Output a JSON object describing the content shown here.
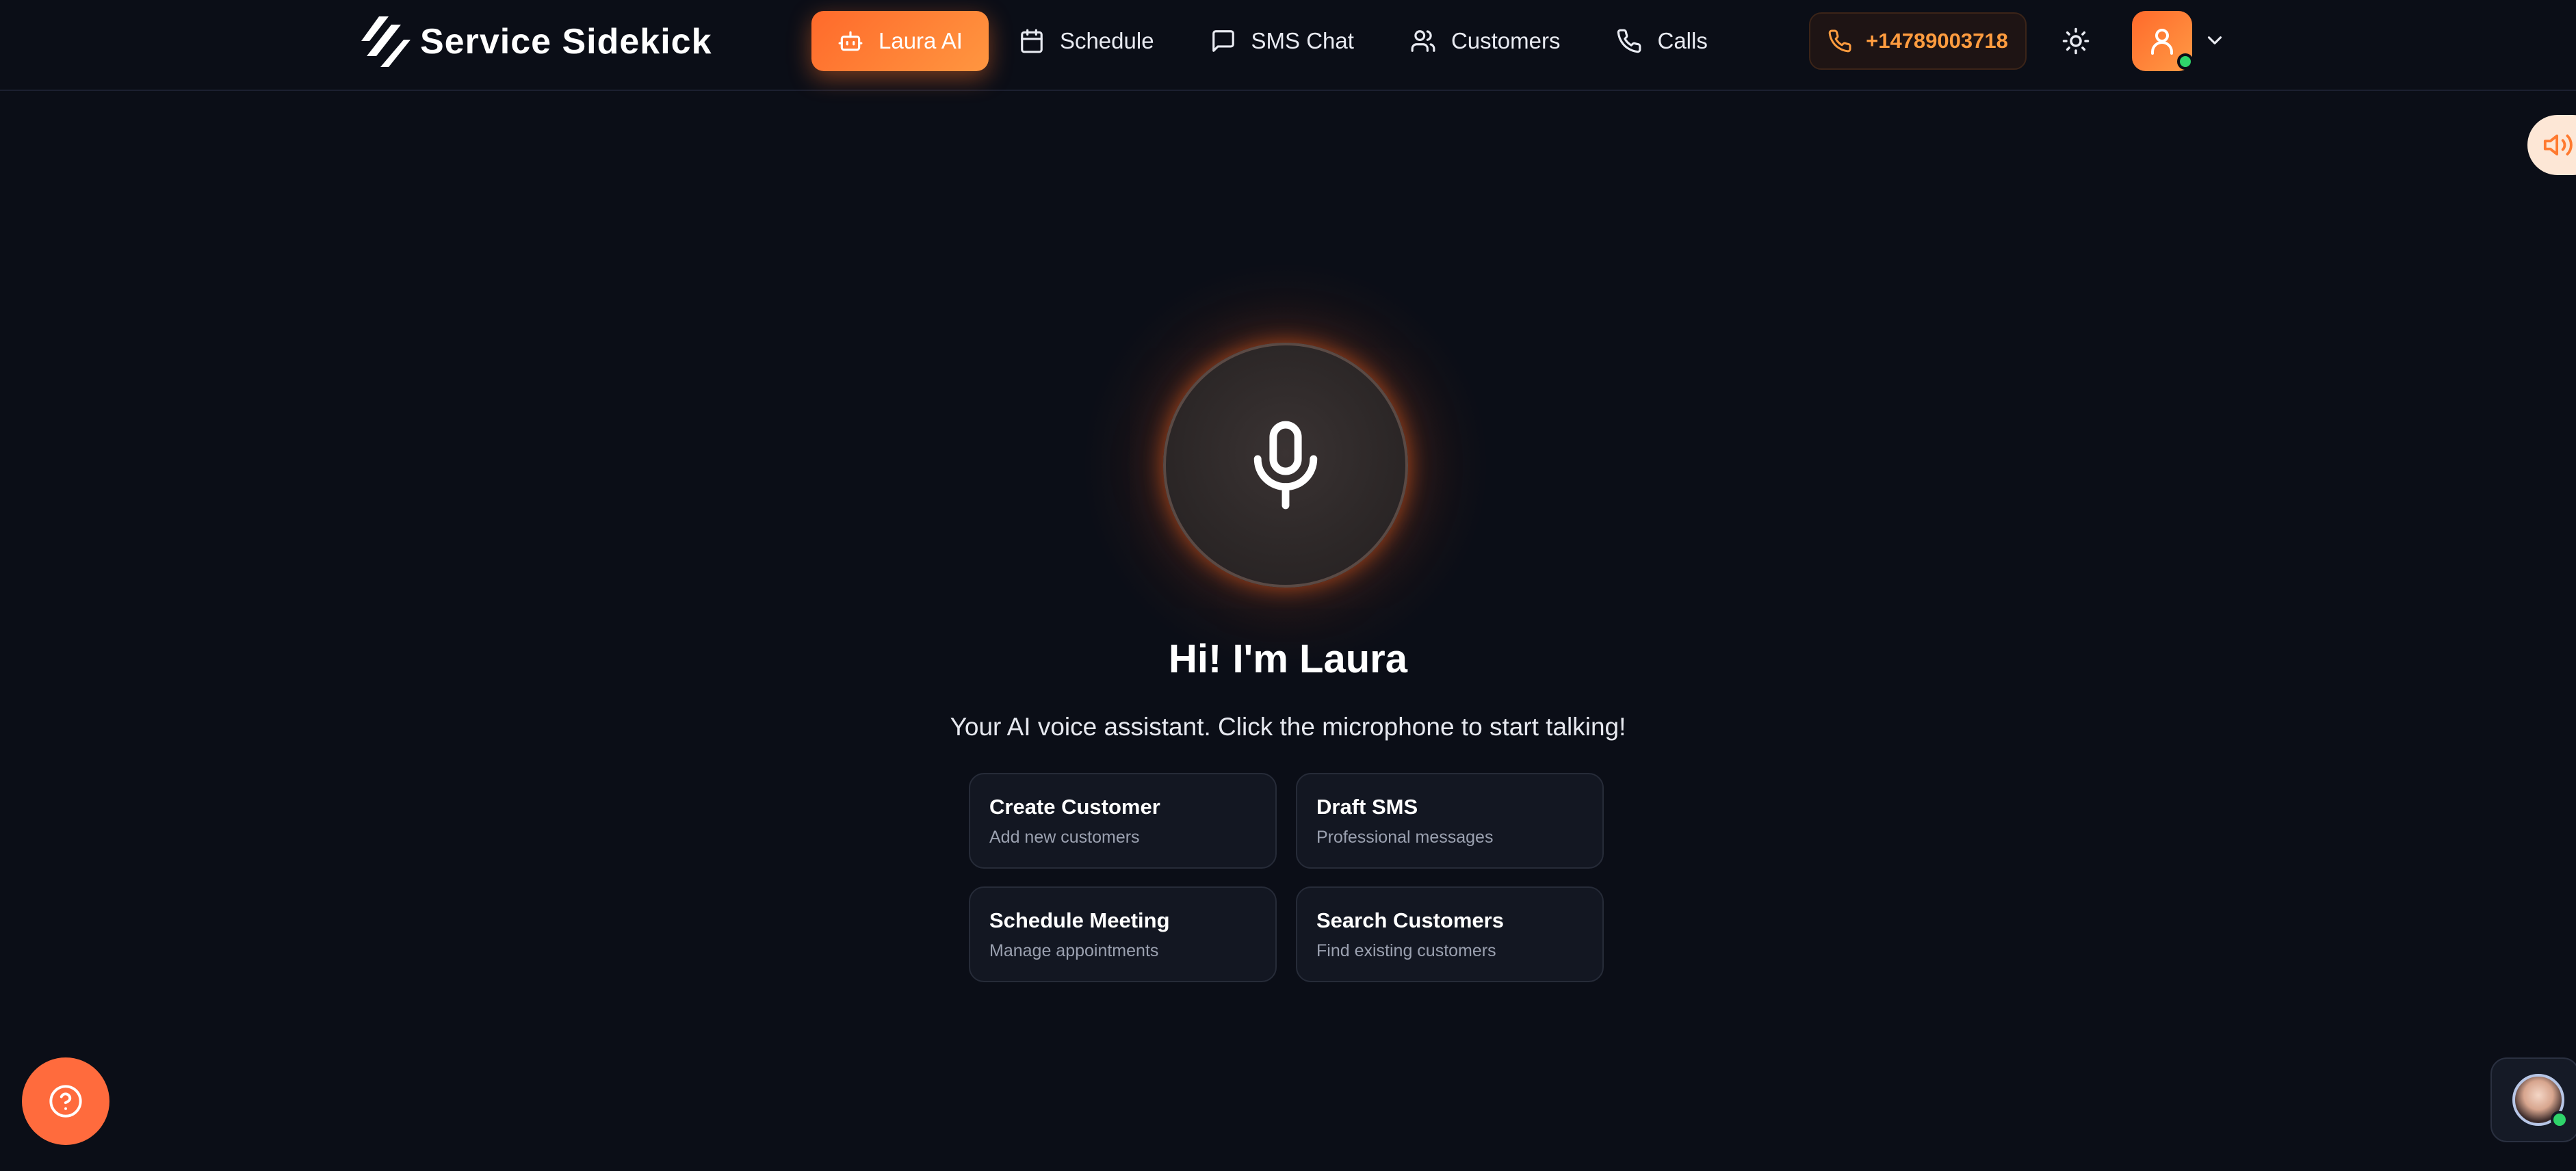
{
  "brand": {
    "name": "Service Sidekick"
  },
  "nav": {
    "items": [
      {
        "label": "Laura AI",
        "icon": "bot-icon",
        "active": true
      },
      {
        "label": "Schedule",
        "icon": "calendar-icon",
        "active": false
      },
      {
        "label": "SMS Chat",
        "icon": "message-icon",
        "active": false
      },
      {
        "label": "Customers",
        "icon": "users-icon",
        "active": false
      },
      {
        "label": "Calls",
        "icon": "phone-icon",
        "active": false
      }
    ]
  },
  "header": {
    "phone_number": "+14789003718",
    "theme_icon": "sun-icon",
    "user_icon": "user-icon",
    "user_status": "online"
  },
  "assistant": {
    "greeting": "Hi! I'm Laura",
    "subtitle": "Your AI voice assistant. Click the microphone to start talking!",
    "mic_icon": "microphone-icon"
  },
  "actions": [
    {
      "title": "Create Customer",
      "subtitle": "Add new customers"
    },
    {
      "title": "Draft SMS",
      "subtitle": "Professional messages"
    },
    {
      "title": "Schedule Meeting",
      "subtitle": "Manage appointments"
    },
    {
      "title": "Search Customers",
      "subtitle": "Find existing customers"
    }
  ],
  "colors": {
    "accent": "#ff7a2f",
    "background": "#0b0e17",
    "phone_text": "#ff9c3f",
    "online": "#2fd46a"
  }
}
